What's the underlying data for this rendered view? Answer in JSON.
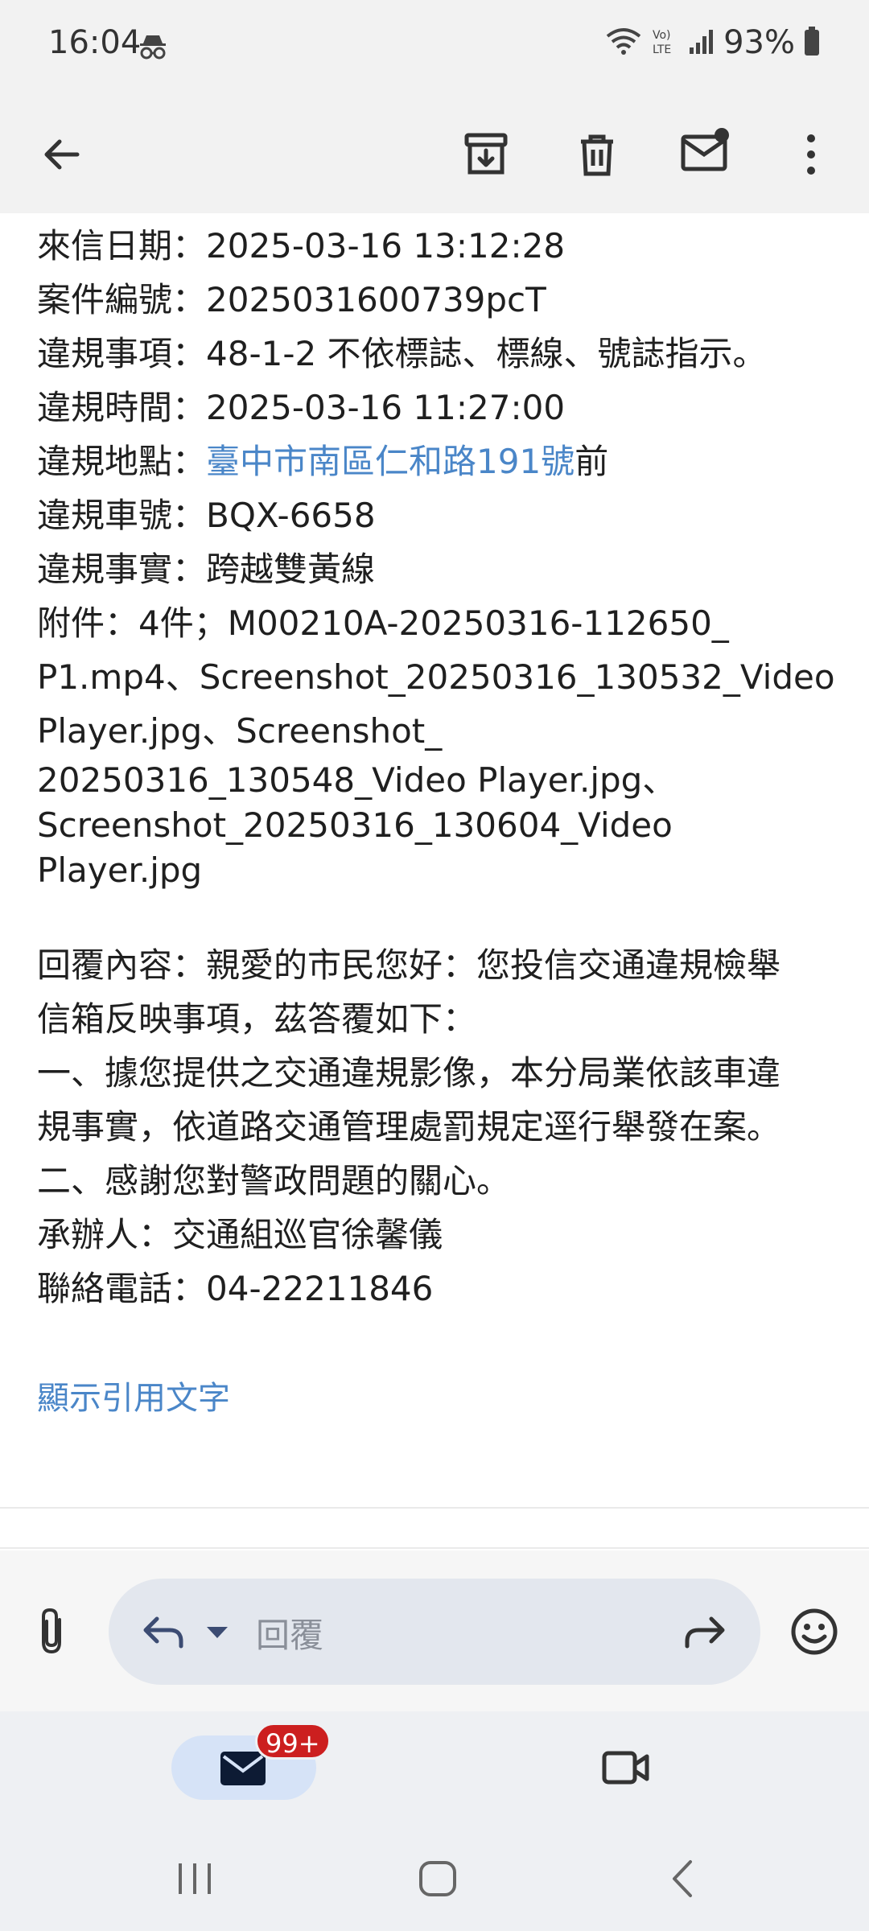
{
  "status_bar": {
    "time": "16:04",
    "battery": "93%",
    "icons": [
      "incognito-icon",
      "wifi-icon",
      "volte-icon",
      "signal-icon",
      "battery-icon"
    ]
  },
  "toolbar": {
    "icons": [
      "back-arrow-icon",
      "archive-icon",
      "trash-icon",
      "mark-unread-icon",
      "more-vert-icon"
    ]
  },
  "email": {
    "received_date": "來信日期：2025-03-16 13:12:28",
    "case_number": "案件編號：2025031600739pcT",
    "violation_item": "違規事項：48-1-2 不依標誌、標線、號誌指示。",
    "violation_time": "違規時間：2025-03-16 11:27:00",
    "location_label": "違規地點：",
    "location_link": "臺中市南區仁和路191號",
    "location_suffix": "前",
    "plate": "違規車號：BQX-6658",
    "fact": "違規事實：跨越雙黃線",
    "attachments_1": "附件：4件；M00210A-20250316-112650_",
    "attachments_2": "P1.mp4、Screenshot_20250316_130532_Video",
    "attachments_3": "Player.jpg、Screenshot_",
    "attachments_4": "20250316_130548_Video Player.jpg、",
    "attachments_5": "Screenshot_20250316_130604_Video",
    "attachments_6": "Player.jpg",
    "reply_1": "回覆內容：親愛的市民您好：您投信交通違規檢舉",
    "reply_2": "信箱反映事項，茲答覆如下：",
    "reply_3": "一、據您提供之交通違規影像，本分局業依該車違",
    "reply_4": "規事實，依道路交通管理處罰規定逕行舉發在案。",
    "reply_5": "二、感謝您對警政問題的關心。",
    "handler": "承辦人：交通組巡官徐馨儀",
    "phone": "聯絡電話：04-22211846",
    "show_quoted": "顯示引用文字"
  },
  "reply_bar": {
    "placeholder": "回覆"
  },
  "bottom_nav": {
    "badge": "99+"
  },
  "colors": {
    "link": "#4a86c8",
    "badge": "#cc1f1f",
    "pill": "#d6e3f7"
  }
}
